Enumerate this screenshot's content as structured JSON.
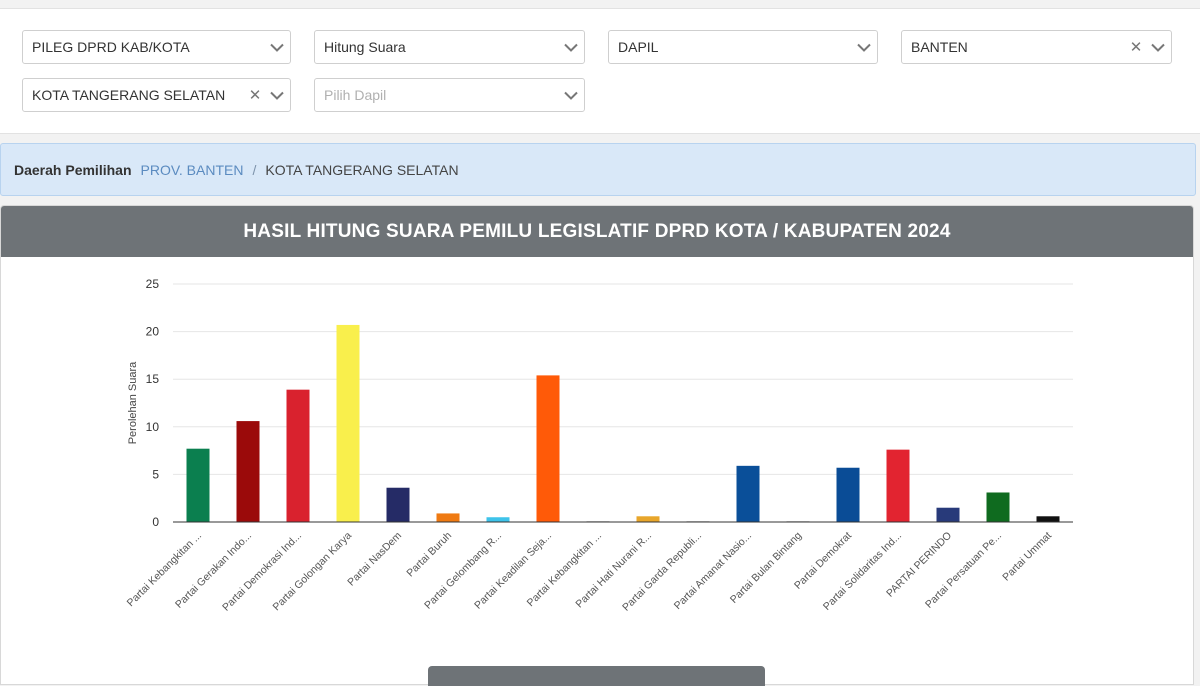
{
  "filters": {
    "election_type": "PILEG DPRD KAB/KOTA",
    "mode": "Hitung Suara",
    "level": "DAPIL",
    "province": "BANTEN",
    "city": "KOTA TANGERANG SELATAN",
    "dapil_placeholder": "Pilih Dapil"
  },
  "breadcrumb": {
    "label": "Daerah Pemilihan",
    "province": "PROV. BANTEN",
    "separator": "/",
    "current": "KOTA TANGERANG SELATAN"
  },
  "chart_header": {
    "title": "HASIL HITUNG SUARA PEMILU LEGISLATIF DPRD KOTA / KABUPATEN 2024"
  },
  "chart_data": {
    "type": "bar",
    "ylabel": "Perolehan Suara",
    "ylim": [
      0,
      25
    ],
    "yticks": [
      0,
      5,
      10,
      15,
      20,
      25
    ],
    "grid": true,
    "categories": [
      "Partai Kebangkitan ...",
      "Partai Gerakan Indo...",
      "Partai Demokrasi Ind...",
      "Partai Golongan Karya",
      "Partai NasDem",
      "Partai Buruh",
      "Partai Gelombang R...",
      "Partai Keadilan Seja...",
      "Partai Kebangkitan ...",
      "Partai Hati Nurani R...",
      "Partai Garda Republi...",
      "Partai Amanat Nasio...",
      "Partai Bulan Bintang",
      "Partai Demokrat",
      "Partai Solidaritas Ind...",
      "PARTAI PERINDO",
      "Partai Persatuan Pe...",
      "Partai Ummat"
    ],
    "values": [
      7.7,
      10.6,
      13.9,
      20.7,
      3.6,
      0.9,
      0.5,
      15.4,
      0.1,
      0.6,
      0.1,
      5.9,
      0.1,
      5.7,
      7.6,
      1.5,
      3.1,
      0.6
    ],
    "colors": [
      "#0b7f4f",
      "#9b0a0a",
      "#d9222e",
      "#f9ef4c",
      "#252b66",
      "#ef7a12",
      "#3ec3ea",
      "#ff5a08",
      "#cfcfcf",
      "#e8a62b",
      "#cfcfcf",
      "#0a4f99",
      "#cfcfcf",
      "#0a4c96",
      "#e22430",
      "#283a7a",
      "#0f6b1f",
      "#111111"
    ]
  },
  "icons": {
    "chevron": "chevron-down-icon",
    "clear": "clear-icon"
  }
}
